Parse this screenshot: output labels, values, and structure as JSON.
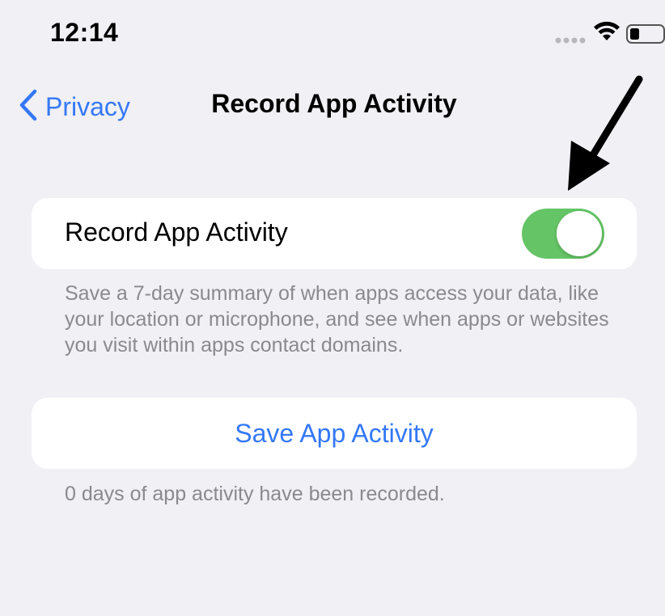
{
  "status_bar": {
    "time": "12:14",
    "icons": [
      "signal-dots-icon",
      "wifi-icon",
      "battery-icon"
    ]
  },
  "nav": {
    "back_label": "Privacy",
    "title": "Record App Activity"
  },
  "record_toggle": {
    "label": "Record App Activity",
    "enabled": true,
    "on_color": "#65c466"
  },
  "record_footer": "Save a 7-day summary of when apps access your data, like your location or microphone, and see when apps or websites you visit within apps contact domains.",
  "save_button": {
    "label": "Save App Activity"
  },
  "save_footer": "0 days of app activity have been recorded.",
  "colors": {
    "accent": "#3478f6",
    "background": "#f0f0f5",
    "secondary_text": "#8a8a8e"
  }
}
